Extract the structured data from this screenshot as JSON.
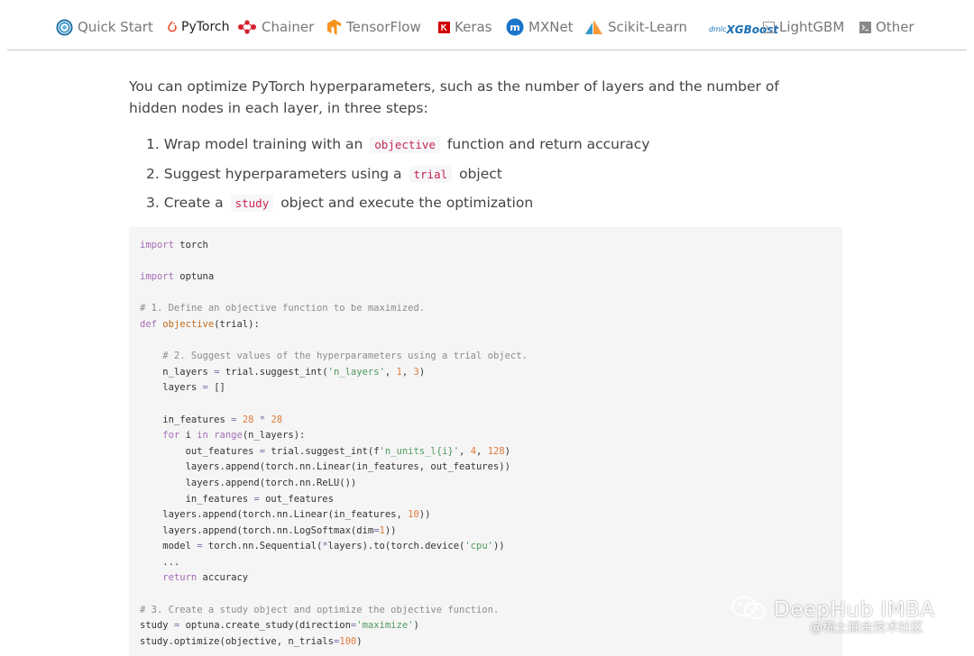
{
  "tabs": [
    {
      "label": "Quick Start",
      "icon": "optuna-icon"
    },
    {
      "label": "PyTorch",
      "icon": "pytorch-icon",
      "active": true
    },
    {
      "label": "Chainer",
      "icon": "chainer-icon"
    },
    {
      "label": "TensorFlow",
      "icon": "tensorflow-icon"
    },
    {
      "label": "Keras",
      "icon": "keras-icon"
    },
    {
      "label": "MXNet",
      "icon": "mxnet-icon"
    },
    {
      "label": "Scikit-Learn",
      "icon": "scikit-learn-icon"
    },
    {
      "label": "XGBoost",
      "logo_text": "dmlc",
      "icon": "xgboost-icon"
    },
    {
      "label": "LightGBM",
      "icon": "lightgbm-icon"
    },
    {
      "label": "Other",
      "icon": "terminal-icon"
    }
  ],
  "intro": "You can optimize PyTorch hyperparameters, such as the number of layers and the number of hidden nodes in each layer, in three steps:",
  "steps": [
    {
      "num": "1.",
      "before": "Wrap model training with an",
      "code": "objective",
      "after": "function and return accuracy"
    },
    {
      "num": "2.",
      "before": "Suggest hyperparameters using a",
      "code": "trial",
      "after": "object"
    },
    {
      "num": "3.",
      "before": "Create a",
      "code": "study",
      "after": "object and execute the optimization"
    }
  ],
  "code_lines": [
    "import torch",
    "",
    "import optuna",
    "",
    "# 1. Define an objective function to be maximized.",
    "def objective(trial):",
    "",
    "    # 2. Suggest values of the hyperparameters using a trial object.",
    "    n_layers = trial.suggest_int('n_layers', 1, 3)",
    "    layers = []",
    "",
    "    in_features = 28 * 28",
    "    for i in range(n_layers):",
    "        out_features = trial.suggest_int(f'n_units_l{i}', 4, 128)",
    "        layers.append(torch.nn.Linear(in_features, out_features))",
    "        layers.append(torch.nn.ReLU())",
    "        in_features = out_features",
    "    layers.append(torch.nn.Linear(in_features, 10))",
    "    layers.append(torch.nn.LogSoftmax(dim=1))",
    "    model = torch.nn.Sequential(*layers).to(torch.device('cpu'))",
    "    ...",
    "    return accuracy",
    "",
    "# 3. Create a study object and optimize the objective function.",
    "study = optuna.create_study(direction='maximize')",
    "study.optimize(objective, n_trials=100)"
  ],
  "watermark": {
    "title": "DeepHub IMBA",
    "subtitle": "@稀土掘金技术社区"
  },
  "colors": {
    "keyword": "#a46db5",
    "function": "#c66b1e",
    "comment": "#8c8c8c",
    "string": "#4e9a5d",
    "number": "#e07b3a",
    "inline_code": "#c7254e"
  }
}
